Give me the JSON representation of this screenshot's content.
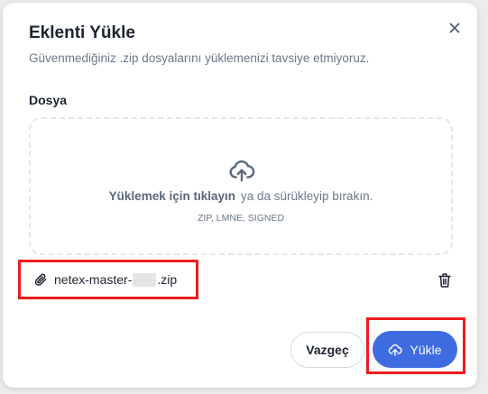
{
  "dialog": {
    "title": "Eklenti Yükle",
    "subtitle": "Güvenmediğiniz .zip dosyalarını yüklemenizi tavsiye etmiyoruz.",
    "close_icon": "close-icon"
  },
  "file_field": {
    "label": "Dosya",
    "dropzone": {
      "icon": "cloud-upload-icon",
      "cta": "Yüklemek için tıklayın",
      "text": "ya da sürükleyip bırakın.",
      "hint": "ZIP, LMNE, SIGNED"
    },
    "selected_file": {
      "icon": "paperclip-icon",
      "name_prefix": "netex-master-",
      "name_suffix": ".zip",
      "remove_icon": "trash-icon"
    }
  },
  "footer": {
    "cancel_label": "Vazgeç",
    "upload_label": "Yükle",
    "upload_icon": "cloud-upload-icon"
  },
  "colors": {
    "primary": "#3e6be0",
    "highlight": "#ee1c1c",
    "text": "#1c2430",
    "muted": "#6b7789"
  }
}
